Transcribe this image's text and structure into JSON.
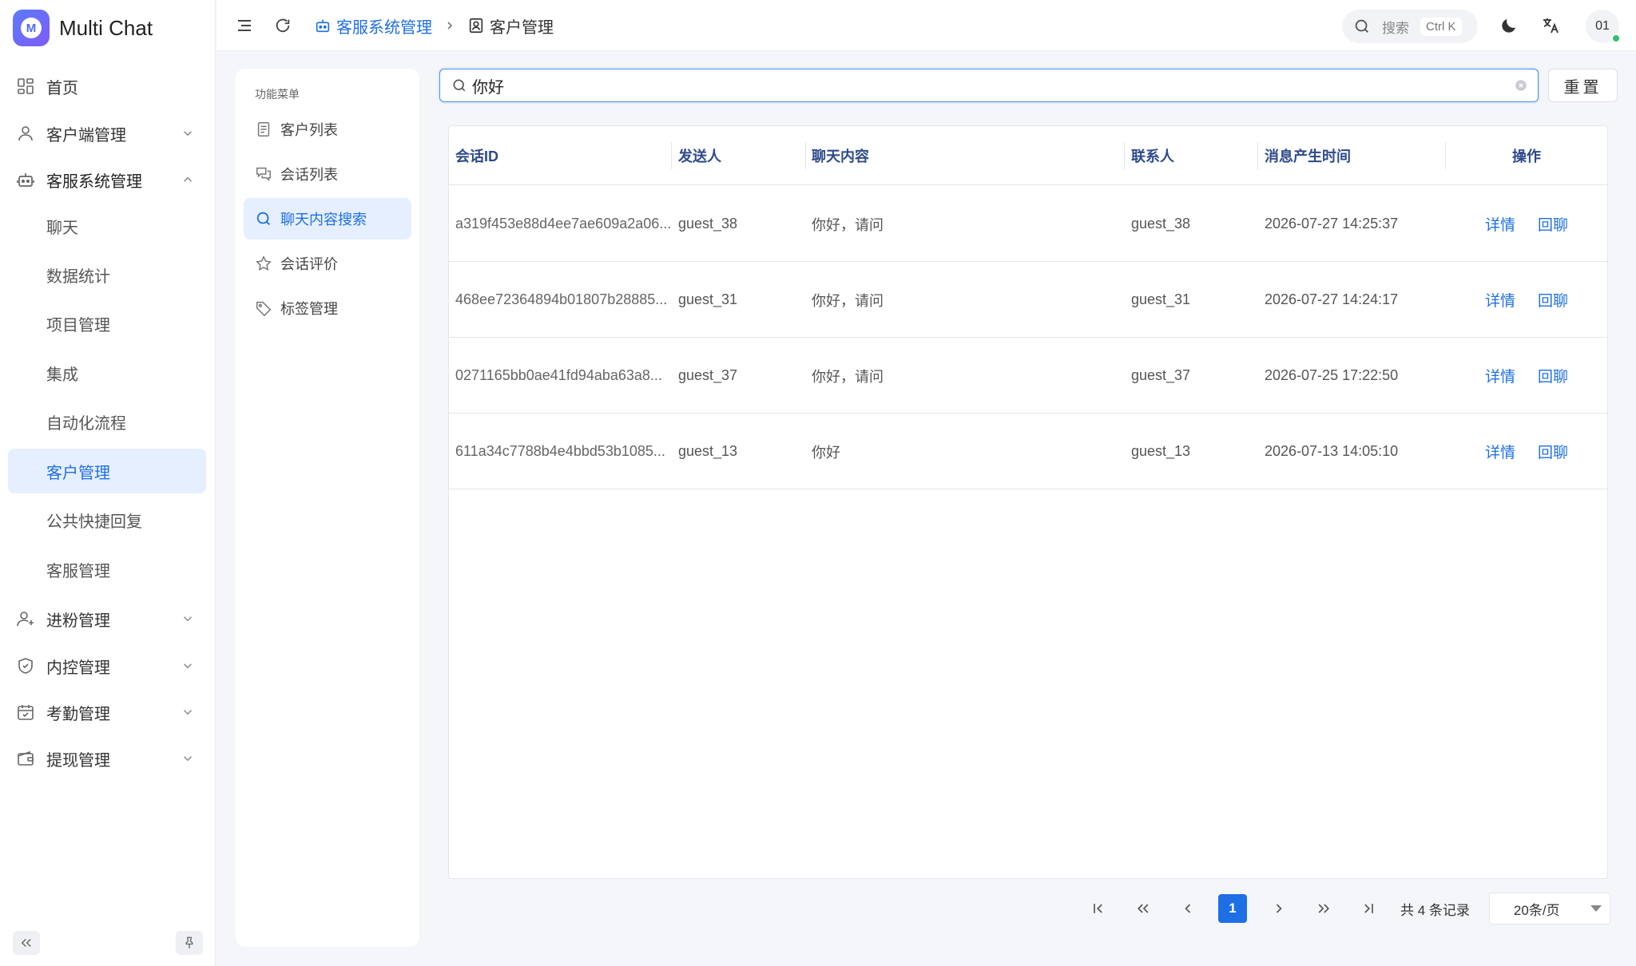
{
  "brand": {
    "name": "Multi Chat",
    "logo_letter": "M"
  },
  "sidebar": {
    "items": [
      {
        "label": "首页",
        "icon": "dashboard-icon"
      },
      {
        "label": "客户端管理",
        "icon": "user-icon"
      },
      {
        "label": "客服系统管理",
        "icon": "robot-icon"
      },
      {
        "label": "聊天"
      },
      {
        "label": "数据统计"
      },
      {
        "label": "项目管理"
      },
      {
        "label": "集成"
      },
      {
        "label": "自动化流程"
      },
      {
        "label": "客户管理"
      },
      {
        "label": "公共快捷回复"
      },
      {
        "label": "客服管理"
      },
      {
        "label": "进粉管理",
        "icon": "user-add-icon"
      },
      {
        "label": "内控管理",
        "icon": "shield-icon"
      },
      {
        "label": "考勤管理",
        "icon": "calendar-check-icon"
      },
      {
        "label": "提现管理",
        "icon": "wallet-icon"
      }
    ]
  },
  "header": {
    "breadcrumb": [
      {
        "label": "客服系统管理",
        "icon": "robot-icon"
      },
      {
        "label": "客户管理",
        "icon": "contact-icon"
      }
    ],
    "search": {
      "placeholder": "搜索",
      "shortcut": "Ctrl K"
    },
    "user_avatar": "01"
  },
  "func_menu": {
    "title": "功能菜单",
    "items": [
      {
        "label": "客户列表",
        "icon": "document-icon"
      },
      {
        "label": "会话列表",
        "icon": "chat-bubbles-icon"
      },
      {
        "label": "聊天内容搜索",
        "icon": "search-icon"
      },
      {
        "label": "会话评价",
        "icon": "star-icon"
      },
      {
        "label": "标签管理",
        "icon": "tag-icon"
      }
    ]
  },
  "search": {
    "value": "你好"
  },
  "reset_label": "重置",
  "table": {
    "columns": [
      "会话ID",
      "发送人",
      "聊天内容",
      "联系人",
      "消息产生时间",
      "操作"
    ],
    "rows": [
      {
        "id": "a319f453e88d4ee7ae609a2a06...",
        "sender": "guest_38",
        "content": "你好，请问",
        "contact": "guest_38",
        "time": "2026-07-27 14:25:37"
      },
      {
        "id": "468ee72364894b01807b28885...",
        "sender": "guest_31",
        "content": "你好，请问",
        "contact": "guest_31",
        "time": "2026-07-27 14:24:17"
      },
      {
        "id": "0271165bb0ae41fd94aba63a8...",
        "sender": "guest_37",
        "content": "你好，请问",
        "contact": "guest_37",
        "time": "2026-07-25 17:22:50"
      },
      {
        "id": "611a34c7788b4e4bbd53b1085...",
        "sender": "guest_13",
        "content": "你好",
        "contact": "guest_13",
        "time": "2026-07-13 14:05:10"
      }
    ],
    "actions": {
      "detail": "详情",
      "reply": "回聊"
    }
  },
  "pagination": {
    "current_page": "1",
    "total_text": "共 4 条记录",
    "page_size": "20条/页"
  },
  "colors": {
    "accent": "#1e6fe6",
    "active_bg": "#e6efff",
    "online": "#2ec26a"
  }
}
